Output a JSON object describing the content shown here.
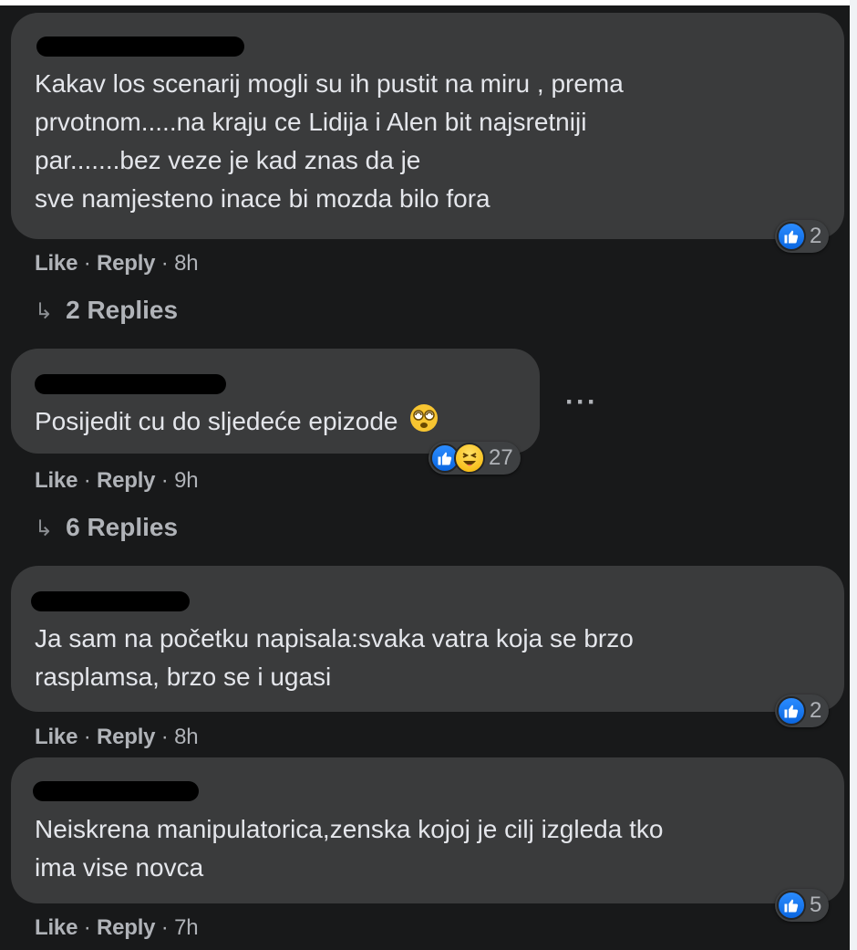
{
  "comments": [
    {
      "text_lines": [
        "Kakav los scenarij mogli su ih pustit na miru , prema",
        "prvotnom.....na kraju ce Lidija i Alen bit najsretniji",
        "par.......bez veze je kad znas da je",
        "sve namjesteno inace bi mozda bilo fora"
      ],
      "like_label": "Like",
      "reply_label": "Reply",
      "separator": "·",
      "time": "8h",
      "reaction_count": "2",
      "replies_label": "2 Replies"
    },
    {
      "text_lines": [
        "Posijedit cu do sljedeće epizode"
      ],
      "like_label": "Like",
      "reply_label": "Reply",
      "separator": "·",
      "time": "9h",
      "reaction_count": "27",
      "replies_label": "6 Replies",
      "more_label": "···"
    },
    {
      "text_lines": [
        "Ja sam na početku napisala:svaka vatra koja se brzo",
        "rasplamsa, brzo se i ugasi"
      ],
      "like_label": "Like",
      "reply_label": "Reply",
      "separator": "·",
      "time": "8h",
      "reaction_count": "2"
    },
    {
      "text_lines": [
        "Neiskrena manipulatorica,zenska kojoj je cilj izgleda tko",
        "ima vise novca"
      ],
      "like_label": "Like",
      "reply_label": "Reply",
      "separator": "·",
      "time": "7h",
      "reaction_count": "5"
    }
  ],
  "reply_arrow": "↳",
  "icons": {
    "like": "like-reaction-icon",
    "haha": "haha-reaction-icon",
    "emoji": "dizzy-face-emoji-icon"
  },
  "colors": {
    "background": "#18191a",
    "bubble": "#3a3b3c",
    "text": "#e4e6eb",
    "meta": "#b0b3b8",
    "like_blue": "#1877f2"
  }
}
